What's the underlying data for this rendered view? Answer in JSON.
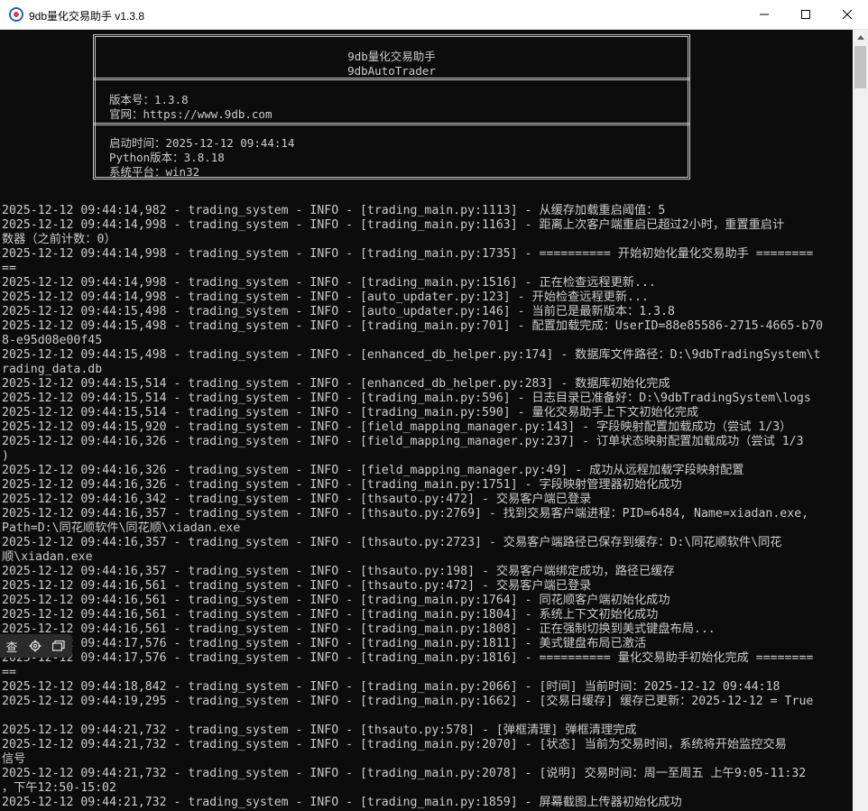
{
  "window": {
    "title": "9db量化交易助手 v1.3.8",
    "icon": "app-logo-icon",
    "controls": [
      "minimize-icon",
      "maximize-icon",
      "close-icon"
    ]
  },
  "banner": {
    "name_cn": "9db量化交易助手",
    "name_en": "9dbAutoTrader",
    "version": "版本号：1.3.8",
    "website": "官网：https://www.9db.com",
    "start_time": "启动时间：2025-12-12 09:44:14",
    "python_version": "Python版本：3.8.18",
    "platform": "系统平台：win32"
  },
  "log_lines": [
    "2025-12-12 09:44:14,982 - trading_system - INFO - [trading_main.py:1113] - 从缓存加载重启阈值：5",
    "2025-12-12 09:44:14,998 - trading_system - INFO - [trading_main.py:1163] - 距离上次客户端重启已超过2小时，重置重启计",
    "数器（之前计数：0）",
    "2025-12-12 09:44:14,998 - trading_system - INFO - [trading_main.py:1735] - ========== 开始初始化量化交易助手 ========",
    "==",
    "2025-12-12 09:44:14,998 - trading_system - INFO - [trading_main.py:1516] - 正在检查远程更新...",
    "2025-12-12 09:44:14,998 - trading_system - INFO - [auto_updater.py:123] - 开始检查远程更新...",
    "2025-12-12 09:44:15,498 - trading_system - INFO - [auto_updater.py:146] - 当前已是最新版本：1.3.8",
    "2025-12-12 09:44:15,498 - trading_system - INFO - [trading_main.py:701] - 配置加载完成：UserID=88e85586-2715-4665-b70",
    "8-e95d08e00f45",
    "2025-12-12 09:44:15,498 - trading_system - INFO - [enhanced_db_helper.py:174] - 数据库文件路径：D:\\9dbTradingSystem\\t",
    "rading_data.db",
    "2025-12-12 09:44:15,514 - trading_system - INFO - [enhanced_db_helper.py:283] - 数据库初始化完成",
    "2025-12-12 09:44:15,514 - trading_system - INFO - [trading_main.py:596] - 日志目录已准备好：D:\\9dbTradingSystem\\logs",
    "2025-12-12 09:44:15,514 - trading_system - INFO - [trading_main.py:590] - 量化交易助手上下文初始化完成",
    "2025-12-12 09:44:15,920 - trading_system - INFO - [field_mapping_manager.py:143] - 字段映射配置加载成功（尝试 1/3）",
    "2025-12-12 09:44:16,326 - trading_system - INFO - [field_mapping_manager.py:237] - 订单状态映射配置加载成功（尝试 1/3",
    ")",
    "2025-12-12 09:44:16,326 - trading_system - INFO - [field_mapping_manager.py:49] - 成功从远程加载字段映射配置",
    "2025-12-12 09:44:16,326 - trading_system - INFO - [trading_main.py:1751] - 字段映射管理器初始化成功",
    "2025-12-12 09:44:16,342 - trading_system - INFO - [thsauto.py:472] - 交易客户端已登录",
    "2025-12-12 09:44:16,357 - trading_system - INFO - [thsauto.py:2769] - 找到交易客户端进程：PID=6484, Name=xiadan.exe,",
    "Path=D:\\同花顺软件\\同花顺\\xiadan.exe",
    "2025-12-12 09:44:16,357 - trading_system - INFO - [thsauto.py:2723] - 交易客户端路径已保存到缓存：D:\\同花顺软件\\同花",
    "顺\\xiadan.exe",
    "2025-12-12 09:44:16,357 - trading_system - INFO - [thsauto.py:198] - 交易客户端绑定成功，路径已缓存",
    "2025-12-12 09:44:16,561 - trading_system - INFO - [thsauto.py:472] - 交易客户端已登录",
    "2025-12-12 09:44:16,561 - trading_system - INFO - [trading_main.py:1764] - 同花顺客户端初始化成功",
    "2025-12-12 09:44:16,561 - trading_system - INFO - [trading_main.py:1804] - 系统上下文初始化成功",
    "2025-12-12 09:44:16,561 - trading_system - INFO - [trading_main.py:1808] - 正在强制切换到美式键盘布局...",
    "2025-12-12 09:44:17,576 - trading_system - INFO - [trading_main.py:1811] - 美式键盘布局已激活",
    "2025-12-12 09:44:17,576 - trading_system - INFO - [trading_main.py:1816] - ========== 量化交易助手初始化完成 ========",
    "==",
    "2025-12-12 09:44:18,842 - trading_system - INFO - [trading_main.py:2066] - [时间] 当前时间：2025-12-12 09:44:18",
    "2025-12-12 09:44:19,295 - trading_system - INFO - [trading_main.py:1662] - [交易日缓存] 缓存已更新：2025-12-12 = True",
    "",
    "2025-12-12 09:44:21,732 - trading_system - INFO - [thsauto.py:578] - [弹框清理] 弹框清理完成",
    "2025-12-12 09:44:21,732 - trading_system - INFO - [trading_main.py:2070] - [状态] 当前为交易时间，系统将开始监控交易",
    "信号",
    "2025-12-12 09:44:21,732 - trading_system - INFO - [trading_main.py:2078] - [说明] 交易时间：周一至周五 上午9:05-11:32",
    "，下午12:50-15:02",
    "2025-12-12 09:44:21,732 - trading_system - INFO - [trading_main.py:1859] - 屏幕截图上传器初始化成功"
  ],
  "floating_toolbar": {
    "items": [
      {
        "label": "查",
        "icon": ""
      },
      {
        "label": "",
        "icon": "gear-icon"
      },
      {
        "label": "",
        "icon": "window-icon"
      }
    ]
  },
  "colors": {
    "console_bg": "#0c0c0c",
    "console_text": "#cccccc",
    "titlebar_bg": "#ffffff"
  }
}
